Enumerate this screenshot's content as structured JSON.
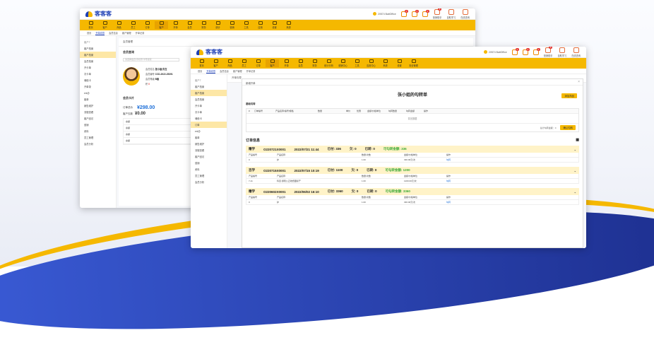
{
  "brand": {
    "name": "客客客"
  },
  "account": "20574 BaitOffice",
  "back_window": {
    "top_links": [
      "营销助手",
      "自助学习",
      "在线咨询"
    ],
    "menu": [
      "首页",
      "客户",
      "商品",
      "员工",
      "订单",
      "客户",
      "开单",
      "会员",
      "财务",
      "统计",
      "营销",
      "工具",
      "应用",
      "设置",
      "系统"
    ],
    "tabs": [
      "首页",
      "开单向导",
      "会员信息",
      "客户管理",
      "开单记录"
    ],
    "sidebar": [
      {
        "label": "客户T",
        "type": "hd"
      },
      {
        "label": "客户档案"
      },
      {
        "label": "客户档案",
        "on": true
      },
      {
        "label": "会员档案"
      },
      {
        "label": "开卡单"
      },
      {
        "label": "次卡单"
      },
      {
        "label": "储值卡"
      },
      {
        "label": "开单录"
      },
      {
        "label": "erk办"
      },
      {
        "label": "客单"
      },
      {
        "label": "销售维护"
      },
      {
        "label": "流程查看"
      },
      {
        "label": "客户回访"
      },
      {
        "label": "营销"
      },
      {
        "label": "资料"
      },
      {
        "label": "员工管理"
      },
      {
        "label": "会员分析"
      }
    ],
    "panel_title": "会员管理",
    "member_title": "会员查询",
    "search_placeholder": "请选择会员/手机号/卡号搜索",
    "member": {
      "name_label": "会员姓名",
      "name": "张小姐/夫在",
      "code_label": "会员编号",
      "code": "CCD-2022-25391",
      "level_label": "会员等级",
      "level": "B级",
      "points_label": "积",
      "points": "0"
    },
    "coupon_title": "会员卡片",
    "account_label": "订单总价",
    "amount": "¥298.00",
    "owed_label": "客户欠款",
    "owed": "¥0.00",
    "mini_rows": [
      "余额",
      "余额",
      "余额",
      "余额"
    ]
  },
  "front_window": {
    "top_links": [
      "营销助手",
      "自助学习",
      "在线咨询"
    ],
    "menu": [
      "首页",
      "客户",
      "商品",
      "员工",
      "订单",
      "客户",
      "开单",
      "会员",
      "财务",
      "统计分析",
      "营销中心",
      "工具",
      "应用中心",
      "系统",
      "设置",
      "安全管理"
    ],
    "tabs": [
      "首页",
      "开单向导",
      "会员信息",
      "客户管理",
      "开单记录"
    ],
    "sidebar": [
      {
        "label": "客户T",
        "type": "hd"
      },
      {
        "label": "客户档案"
      },
      {
        "label": "客户档案",
        "on": true
      },
      {
        "label": "会员档案"
      },
      {
        "label": "开卡单"
      },
      {
        "label": "次卡单"
      },
      {
        "label": "储值卡"
      },
      {
        "label": "订单",
        "on": true
      },
      {
        "label": "erk办"
      },
      {
        "label": "客单"
      },
      {
        "label": "销售维护"
      },
      {
        "label": "流程查看"
      },
      {
        "label": "客户回访"
      },
      {
        "label": "营销"
      },
      {
        "label": "资料"
      },
      {
        "label": "员工管理"
      },
      {
        "label": "会员分析"
      }
    ],
    "breadcrumb": "开单向导",
    "modal_header": "新增开单",
    "modal_title": "张小姐的勾转单",
    "add_btn": "添加商品",
    "section": "基础勾转",
    "grid_cols": [
      "#",
      "订单编号",
      "产品名称/编号/规格",
      "数量",
      "单价",
      "优惠",
      "金额/价格单位",
      "勾转数量",
      "勾转金额",
      "操作"
    ],
    "no_data": "暂无数据",
    "sum_label": "总计勾转金额：0",
    "confirm_btn": "确认勾转",
    "orders_title": "订单信息",
    "orders": [
      {
        "kind": "赠学",
        "no": "O220721X0001",
        "time": "2022/07/21 11:44",
        "paid": "已付: 336",
        "owe": "欠: 0",
        "transferred": "已转: 0",
        "avail": "可勾转金额: 336",
        "rows": [
          {
            "no": "0",
            "name": "护",
            "qty": "1.00",
            "price": "336.00元/次",
            "op": "勾转"
          }
        ]
      },
      {
        "kind": "百学",
        "no": "O220715X0001",
        "time": "2022/07/15 10:19",
        "paid": "已付: 1100",
        "owe": "欠: 0",
        "transferred": "已转: 0",
        "avail": "可勾转金额: 1200",
        "rows": [
          {
            "no": "7-11",
            "name": "科目:通则公正收费图标产",
            "qty": "1.00",
            "price": "1200.00元/次",
            "op": "勾转"
          }
        ]
      },
      {
        "kind": "赠学",
        "no": "O220602X0001",
        "time": "2022/06/02 16:10",
        "paid": "已付: 3360",
        "owe": "欠: 0",
        "transferred": "已转: 0",
        "avail": "可勾转金额: 3360",
        "rows": [
          {
            "no": "0",
            "name": "护",
            "qty": "1.00",
            "price": "336.00元/次",
            "op": "勾转"
          }
        ]
      }
    ],
    "order_cols": [
      "产品编号",
      "产品名称",
      "数量/次数",
      "金额/价格单位",
      "操作"
    ]
  }
}
